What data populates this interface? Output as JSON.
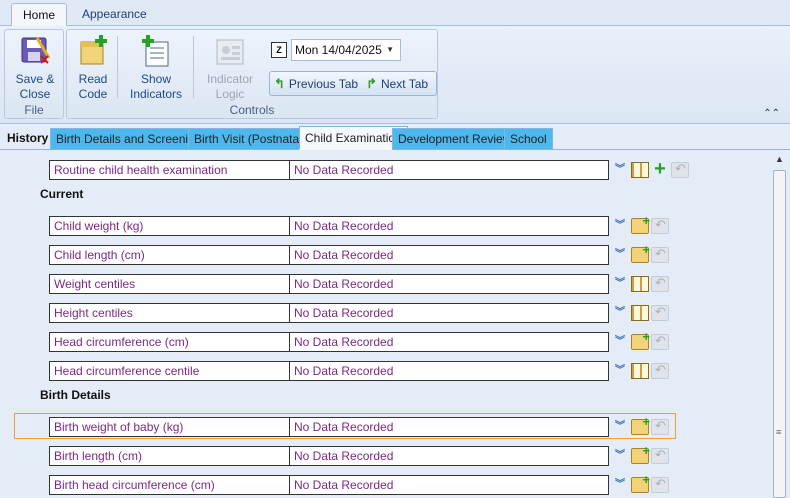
{
  "ribbon_tabs": [
    {
      "label": "Home"
    },
    {
      "label": "Appearance"
    }
  ],
  "ribbon": {
    "file_group": {
      "label": "File",
      "save_close": "Save & Close"
    },
    "controls_group": {
      "label": "Controls",
      "read_code_line1": "Read",
      "read_code_line2": "Code",
      "show_indicators_line1": "Show",
      "show_indicators_line2": "Indicators",
      "indicator_logic_line1": "Indicator",
      "indicator_logic_line2": "Logic",
      "date_value": "Mon 14/04/2025",
      "previous_tab": "Previous Tab",
      "next_tab": "Next Tab"
    }
  },
  "section_tabs": [
    {
      "label": "History"
    },
    {
      "label": "Birth Details and Screening"
    },
    {
      "label": "Birth Visit (Postnatal)"
    },
    {
      "label": "Child Examination"
    },
    {
      "label": "Development Review"
    },
    {
      "label": "School"
    }
  ],
  "content": {
    "top_row": {
      "name": "Routine child health examination",
      "value": "No Data Recorded"
    },
    "current_heading": "Current",
    "current_rows": [
      {
        "name": "Child weight (kg)",
        "value": "No Data Recorded"
      },
      {
        "name": "Child length (cm)",
        "value": "No Data Recorded"
      },
      {
        "name": "Weight centiles",
        "value": "No Data Recorded"
      },
      {
        "name": "Height centiles",
        "value": "No Data Recorded"
      },
      {
        "name": "Head circumference (cm)",
        "value": "No Data Recorded"
      },
      {
        "name": "Head circumference centile",
        "value": "No Data Recorded"
      }
    ],
    "birth_heading": "Birth Details",
    "birth_rows": [
      {
        "name": "Birth weight of baby (kg)",
        "value": "No Data Recorded"
      },
      {
        "name": "Birth length (cm)",
        "value": "No Data Recorded"
      },
      {
        "name": "Birth head circumference (cm)",
        "value": "No Data Recorded"
      }
    ]
  },
  "colors": {
    "accent_tab": "#4db8ef",
    "field_text": "#7a2a82",
    "selection_border": "#f0a030"
  }
}
